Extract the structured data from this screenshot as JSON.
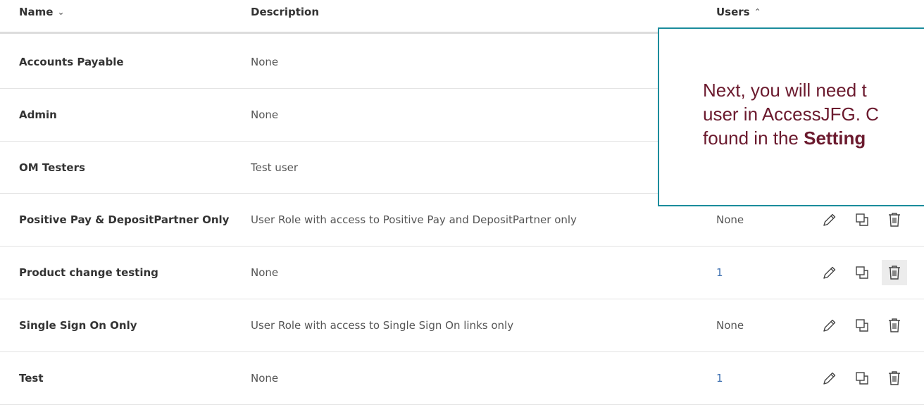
{
  "headers": {
    "name": "Name",
    "description": "Description",
    "users": "Users"
  },
  "rows": [
    {
      "name": "Accounts Payable",
      "description": "None",
      "users": ""
    },
    {
      "name": "Admin",
      "description": "None",
      "users": ""
    },
    {
      "name": "OM Testers",
      "description": "Test user",
      "users": ""
    },
    {
      "name": "Positive Pay & DepositPartner Only",
      "description": "User Role with access to Positive Pay and DepositPartner only",
      "users": "None"
    },
    {
      "name": "Product change testing",
      "description": "None",
      "users": "1"
    },
    {
      "name": "Single Sign On Only",
      "description": "User Role with access to Single Sign On links only",
      "users": "None"
    },
    {
      "name": "Test",
      "description": "None",
      "users": "1"
    }
  ],
  "callout": {
    "line1": "Next, you will need t",
    "line2": "user in AccessJFG.  C",
    "line3_prefix": "found in the ",
    "line3_bold": "Setting"
  },
  "colors": {
    "link": "#3d6fb0",
    "callout_border": "#1a8c9c",
    "callout_text": "#6b1a2e"
  }
}
